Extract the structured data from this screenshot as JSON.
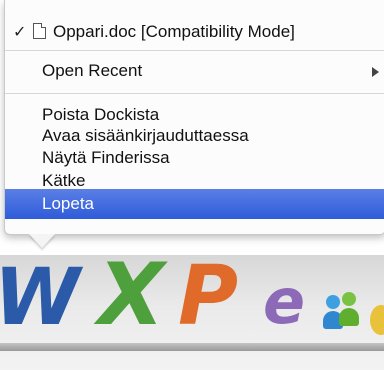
{
  "menu": {
    "document_item": {
      "check": "✓",
      "label": "Oppari.doc [Compatibility Mode]"
    },
    "open_recent": {
      "label": "Open Recent"
    },
    "items": [
      {
        "label": "Poista Dockista"
      },
      {
        "label": "Avaa sisäänkirjauduttaessa"
      },
      {
        "label": "Näytä Finderissa"
      },
      {
        "label": "Kätke"
      },
      {
        "label": "Lopeta"
      }
    ],
    "highlight_color": "#3b66dd"
  },
  "dock": {
    "icons": [
      {
        "name": "word-icon",
        "glyph": "W"
      },
      {
        "name": "excel-icon",
        "glyph": "X"
      },
      {
        "name": "powerpoint-icon",
        "glyph": "P"
      },
      {
        "name": "entourage-icon",
        "glyph": "e"
      },
      {
        "name": "messenger-icon"
      }
    ]
  }
}
